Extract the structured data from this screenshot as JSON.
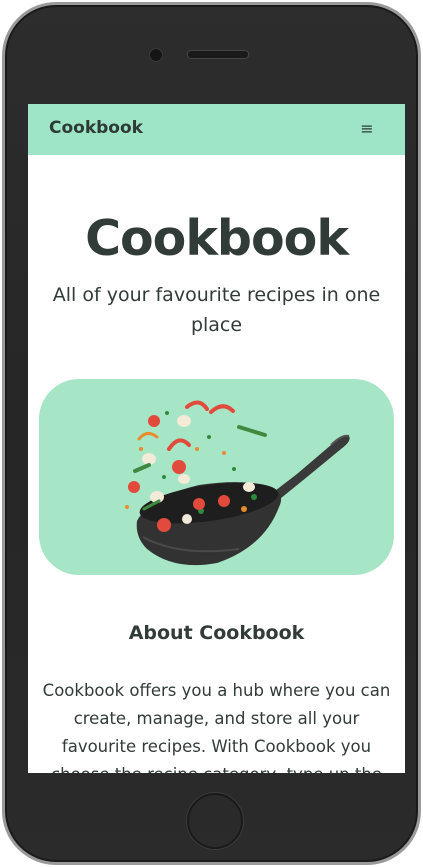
{
  "navbar": {
    "brand": "Cookbook",
    "menu_icon": "hamburger-icon"
  },
  "hero": {
    "title": "Cookbook",
    "subtitle": "All of your favourite recipes in one place",
    "image_icon": "wok-illustration-icon",
    "image_bg": "#a6e6c6"
  },
  "about": {
    "title": "About Cookbook",
    "text": "Cookbook offers you a hub where you can create, manage, and store all your favourite recipes. With Cookbook you choose the recipe category, type up the ingredients and"
  },
  "colors": {
    "accent": "#9ee4c6",
    "text": "#313b37",
    "frame": "#2b2b2b"
  }
}
